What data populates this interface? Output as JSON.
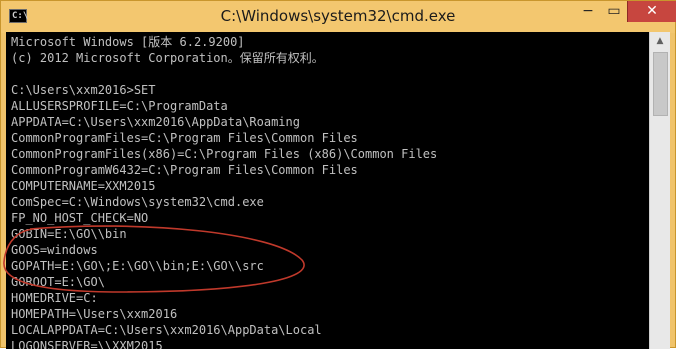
{
  "window": {
    "title": "C:\\Windows\\system32\\cmd.exe",
    "icon_label": "C:\\",
    "controls": {
      "minimize": "−",
      "maximize": "▭",
      "close": "✕"
    }
  },
  "console": {
    "lines": [
      "Microsoft Windows [版本 6.2.9200]",
      "(c) 2012 Microsoft Corporation。保留所有权利。",
      "",
      "C:\\Users\\xxm2016>SET",
      "ALLUSERSPROFILE=C:\\ProgramData",
      "APPDATA=C:\\Users\\xxm2016\\AppData\\Roaming",
      "CommonProgramFiles=C:\\Program Files\\Common Files",
      "CommonProgramFiles(x86)=C:\\Program Files (x86)\\Common Files",
      "CommonProgramW6432=C:\\Program Files\\Common Files",
      "COMPUTERNAME=XXM2015",
      "ComSpec=C:\\Windows\\system32\\cmd.exe",
      "FP_NO_HOST_CHECK=NO",
      "GOBIN=E:\\GO\\\\bin",
      "GOOS=windows",
      "GOPATH=E:\\GO\\;E:\\GO\\\\bin;E:\\GO\\\\src",
      "GOROOT=E:\\GO\\",
      "HOMEDRIVE=C:",
      "HOMEPATH=\\Users\\xxm2016",
      "LOCALAPPDATA=C:\\Users\\xxm2016\\AppData\\Local",
      "LOGONSERVER=\\\\XXM2015"
    ]
  },
  "scrollbar": {
    "up_arrow": "▲"
  },
  "colors": {
    "titlebar": "#f3c76f",
    "console_background": "#000000",
    "console_text": "#c0c0c0",
    "close_button": "#c7463f",
    "annotation": "#c0392b"
  }
}
